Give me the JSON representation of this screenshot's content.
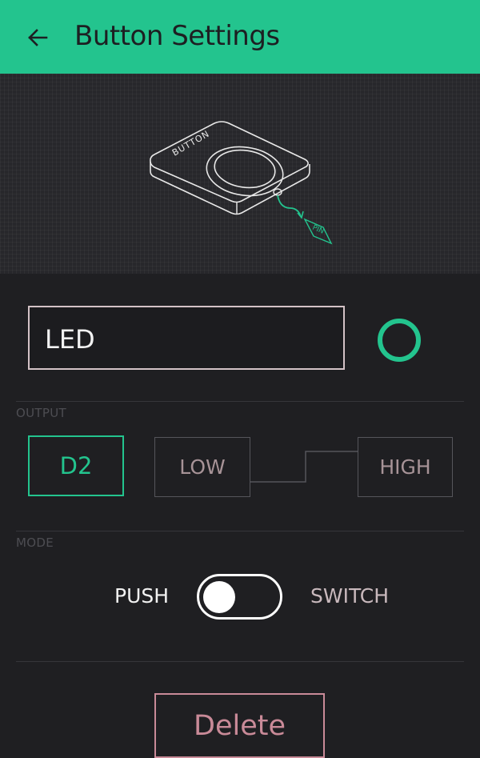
{
  "colors": {
    "accent": "#23c48e",
    "background": "#1f1f22",
    "delete": "#c98a98"
  },
  "header": {
    "title": "Button Settings",
    "back_icon": "arrow-left-icon"
  },
  "illustration": {
    "device_label": "BUTTON",
    "pin_label": "PIN"
  },
  "name_field": {
    "value": "LED"
  },
  "color_picker": {
    "color": "#23c48e",
    "icon": "circle-icon"
  },
  "output": {
    "section_label": "OUTPUT",
    "pin": "D2",
    "low_label": "LOW",
    "high_label": "HIGH"
  },
  "mode": {
    "section_label": "MODE",
    "push_label": "PUSH",
    "switch_label": "SWITCH",
    "selected": "PUSH"
  },
  "delete_label": "Delete"
}
